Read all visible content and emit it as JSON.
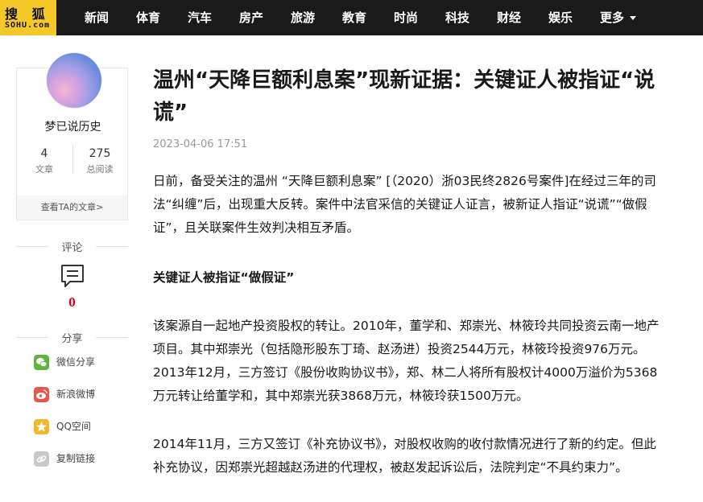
{
  "brand": {
    "logo_cn": "搜 狐",
    "logo_en": "SOHU.com",
    "logo_color": "#f5c82a"
  },
  "nav": {
    "items": [
      "新闻",
      "体育",
      "汽车",
      "房产",
      "旅游",
      "教育",
      "时尚",
      "科技",
      "财经",
      "娱乐"
    ],
    "more": "更多"
  },
  "author": {
    "name": "梦已说历史",
    "articles_count": "4",
    "articles_label": "文章",
    "reads_count": "275",
    "reads_label": "总阅读",
    "view_link": "查看TA的文章>"
  },
  "comments": {
    "label": "评论",
    "icon": "comment-icon",
    "count": "0"
  },
  "share": {
    "label": "分享",
    "items": [
      {
        "label": "微信分享",
        "icon": "wechat-icon",
        "color": "#5fb53b"
      },
      {
        "label": "新浪微博",
        "icon": "weibo-icon",
        "color": "#e6584a"
      },
      {
        "label": "QQ空间",
        "icon": "qzone-icon",
        "color": "#f3b72a"
      },
      {
        "label": "复制链接",
        "icon": "link-icon",
        "color": "#c9c9c9"
      }
    ]
  },
  "article": {
    "title": "温州“天降巨额利息案”现新证据：关键证人被指证“说谎”",
    "time": "2023-04-06 17:51",
    "paragraphs": [
      "日前，备受关注的温州 “天降巨额利息案” [（2020）浙03民终2826号案件]在经过三年的司法“纠缠”后，出现重大反转。案件中法官采信的关键证人证言，被新证人指证“说谎”“做假证”，且关联案件生效判决相互矛盾。",
      "关键证人被指证“做假证”",
      "该案源自一起地产投资股权的转让。2010年，董学和、郑崇光、林筱玲共同投资云南一地产项目。其中郑崇光（包括隐形股东丁琦、赵汤进）投资2544万元，林筱玲投资976万元。2013年12月，三方签订《股份收购协议书》，郑、林二人将所有股权计4000万溢价为5368万元转让给董学和，其中郑崇光获3868万元，林筱玲获1500万元。",
      "2014年11月，三方又签订《补充协议书》，对股权收购的收付款情况进行了新的约定。但此补充协议，因郑崇光超越赵汤进的代理权，被赵发起诉讼后，法院判定“不具约束力”。"
    ]
  }
}
